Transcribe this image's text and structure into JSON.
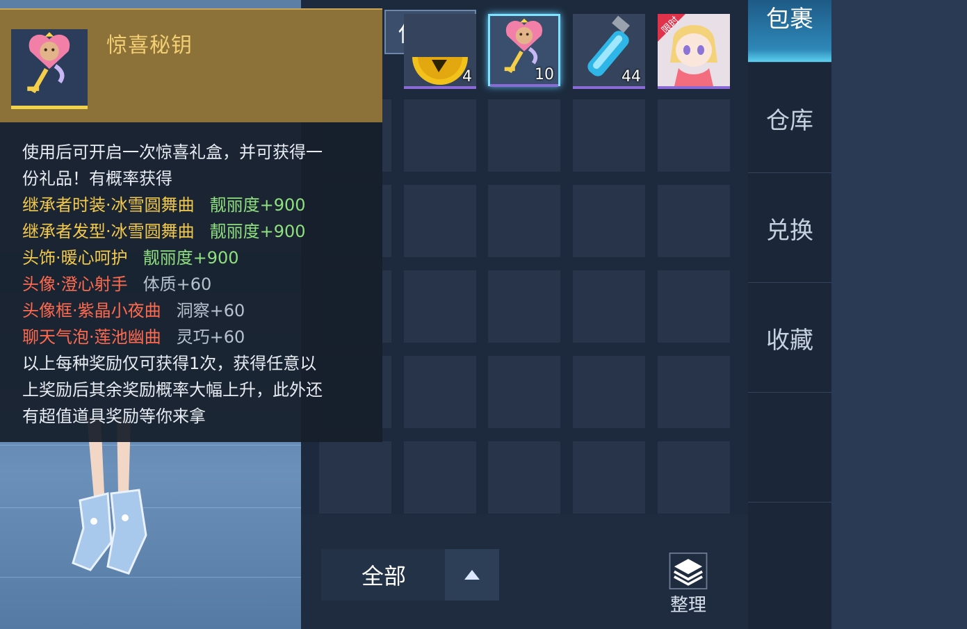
{
  "tooltip": {
    "item_name": "惊喜秘钥",
    "description": [
      "使用后可开启一次惊喜礼盒，并可获得一",
      "份礼品！有概率获得"
    ],
    "rewards": [
      {
        "name": "继承者时装·冰雪圆舞曲",
        "bonus": "靓丽度+900",
        "name_color": "yellow",
        "bonus_color": "green"
      },
      {
        "name": "继承者发型·冰雪圆舞曲",
        "bonus": "靓丽度+900",
        "name_color": "yellow",
        "bonus_color": "green"
      },
      {
        "name": "头饰·暖心呵护",
        "bonus": "靓丽度+900",
        "name_color": "yellow",
        "bonus_color": "green"
      },
      {
        "name": "头像·澄心射手",
        "bonus": "体质+60",
        "name_color": "red",
        "bonus_color": "grey"
      },
      {
        "name": "头像框·紫晶小夜曲",
        "bonus": "洞察+60",
        "name_color": "red",
        "bonus_color": "grey"
      },
      {
        "name": "聊天气泡·莲池幽曲",
        "bonus": "灵巧+60",
        "name_color": "red",
        "bonus_color": "grey"
      }
    ],
    "footer": [
      "以上每种奖励仅可获得1次，获得任意以",
      "上奖励后其余奖励概率大幅上升，此外还",
      "有超值道具奖励等你来拿"
    ]
  },
  "inventory": {
    "use_button": "使 用",
    "items": [
      {
        "icon": "gold-coin-icon",
        "count": "4"
      },
      {
        "icon": "heart-key-icon",
        "count": "10",
        "selected": true
      },
      {
        "icon": "blue-potion-icon",
        "count": "44"
      },
      {
        "icon": "limited-avatar-icon",
        "badge": "限时"
      }
    ]
  },
  "tabs": [
    "包裹",
    "仓库",
    "兑换",
    "收藏"
  ],
  "filter": {
    "label": "全部"
  },
  "sort": {
    "label": "整理"
  },
  "colors": {
    "name_yellow": "#f2c94c",
    "bonus_green": "#8fe07e",
    "name_red": "#ff6a4f",
    "selected_border": "#7fe3ff",
    "rarity_bar": "#8a6ad6",
    "tooltip_header": "#8c7138"
  }
}
